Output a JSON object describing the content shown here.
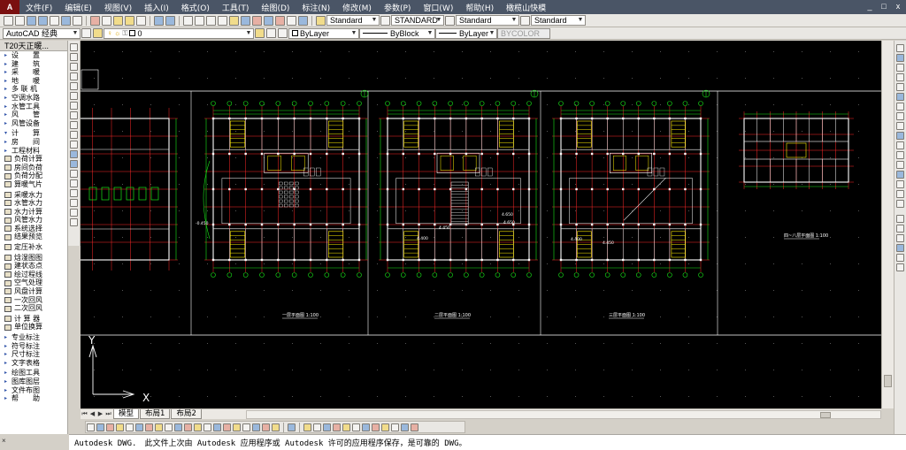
{
  "menubar": {
    "app_icon": "A",
    "items": [
      "文件(F)",
      "编辑(E)",
      "视图(V)",
      "插入(I)",
      "格式(O)",
      "工具(T)",
      "绘图(D)",
      "标注(N)",
      "修改(M)",
      "参数(P)",
      "窗口(W)",
      "帮助(H)",
      "橄榄山快模"
    ],
    "window_controls": [
      "_",
      "□",
      "x"
    ]
  },
  "toolbar1": {
    "text_style": "Standard",
    "dim_style": "STANDARD",
    "table_style": "Standard",
    "multileader_style": "Standard"
  },
  "toolbar2": {
    "workspace": "AutoCAD 经典",
    "layer": "0",
    "color": "ByLayer",
    "linetype": "ByBlock",
    "lineweight": "ByLayer",
    "plotstyle": "BYCOLOR"
  },
  "left_panel": {
    "title": "T20天正暖...",
    "items": [
      {
        "label": "设　　置",
        "kind": "tri"
      },
      {
        "label": "建　　筑",
        "kind": "tri"
      },
      {
        "label": "采　　暖",
        "kind": "tri"
      },
      {
        "label": "地　　暖",
        "kind": "tri"
      },
      {
        "label": "多 联 机",
        "kind": "tri"
      },
      {
        "label": "空调水路",
        "kind": "tri"
      },
      {
        "label": "水管工具",
        "kind": "tri"
      },
      {
        "label": "风　　管",
        "kind": "tri"
      },
      {
        "label": "风管设备",
        "kind": "tri"
      },
      {
        "label": "gap",
        "kind": "gap"
      },
      {
        "label": "计　　算",
        "kind": "head"
      },
      {
        "label": "房　　间",
        "kind": "tri"
      },
      {
        "label": "工程材料",
        "kind": "tri"
      },
      {
        "label": "负荷计算",
        "kind": "sq"
      },
      {
        "label": "房间负荷",
        "kind": "sq"
      },
      {
        "label": "负荷分配",
        "kind": "sq"
      },
      {
        "label": "算暖气片",
        "kind": "sq"
      },
      {
        "label": "gap",
        "kind": "gap"
      },
      {
        "label": "采暖水力",
        "kind": "sq"
      },
      {
        "label": "水管水力",
        "kind": "sq"
      },
      {
        "label": "水力计算",
        "kind": "sq"
      },
      {
        "label": "风管水力",
        "kind": "sq"
      },
      {
        "label": "系统选择",
        "kind": "sq"
      },
      {
        "label": "结果预览",
        "kind": "sq"
      },
      {
        "label": "gap",
        "kind": "gap"
      },
      {
        "label": "定压补水",
        "kind": "sq"
      },
      {
        "label": "gap",
        "kind": "gap"
      },
      {
        "label": "焓湿图图",
        "kind": "sq"
      },
      {
        "label": "建状态点",
        "kind": "sq"
      },
      {
        "label": "绘过程线",
        "kind": "sq"
      },
      {
        "label": "空气处理",
        "kind": "sq"
      },
      {
        "label": "风盘计算",
        "kind": "sq"
      },
      {
        "label": "一次回风",
        "kind": "sq"
      },
      {
        "label": "二次回风",
        "kind": "sq"
      },
      {
        "label": "gap",
        "kind": "gap"
      },
      {
        "label": "计 算 器",
        "kind": "sq"
      },
      {
        "label": "单位换算",
        "kind": "sq"
      },
      {
        "label": "gap",
        "kind": "gap"
      },
      {
        "label": "专业标注",
        "kind": "tri"
      },
      {
        "label": "符号标注",
        "kind": "tri"
      },
      {
        "label": "尺寸标注",
        "kind": "tri"
      },
      {
        "label": "文字表格",
        "kind": "tri"
      },
      {
        "label": "gap",
        "kind": "gap"
      },
      {
        "label": "绘图工具",
        "kind": "tri"
      },
      {
        "label": "图库图层",
        "kind": "tri"
      },
      {
        "label": "文件布图",
        "kind": "tri"
      },
      {
        "label": "帮　　助",
        "kind": "tri"
      }
    ]
  },
  "drawing": {
    "plan_labels": [
      "一层平面图 1:100",
      "二层平面图 1:100",
      "三层平面图 1:100",
      "四~八层平面图 1:100"
    ],
    "dims": [
      "4.450",
      "4.400",
      "4.650",
      "4.650",
      "4.400",
      "4.450",
      "-0.450"
    ],
    "ucs": {
      "x": "X",
      "y": "Y"
    }
  },
  "tabs": {
    "nav": [
      "⏮",
      "◀",
      "▶",
      "⏭"
    ],
    "items": [
      "模型",
      "布局1",
      "布局2"
    ],
    "active": 0
  },
  "command_line": "Autodesk DWG.　此文件上次由 Autodesk 应用程序或 Autodesk 许可的应用程序保存，是可靠的 DWG。",
  "colors": {
    "canvas_bg": "#000000",
    "wall": "#ffffff",
    "axis_red": "#ff2a2a",
    "dim_green": "#19e619",
    "stair_yellow": "#ffee00"
  }
}
